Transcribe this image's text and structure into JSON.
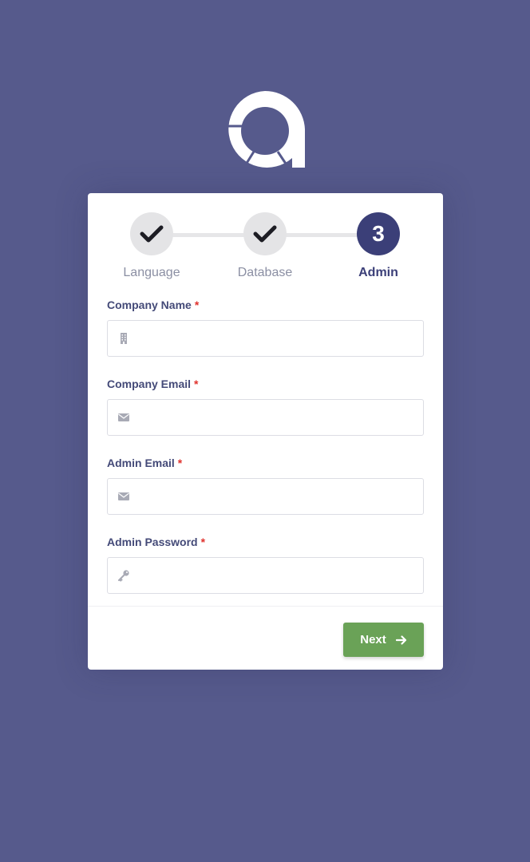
{
  "brand": {
    "logo_icon": "brand-logo-icon"
  },
  "stepper": {
    "steps": [
      {
        "label": "Language",
        "state": "done",
        "icon": "check-icon"
      },
      {
        "label": "Database",
        "state": "done",
        "icon": "check-icon"
      },
      {
        "label": "Admin",
        "state": "active",
        "number": "3"
      }
    ]
  },
  "form": {
    "required_marker": "*",
    "fields": [
      {
        "label": "Company Name",
        "value": "",
        "icon": "building-icon"
      },
      {
        "label": "Company Email",
        "value": "",
        "icon": "envelope-icon"
      },
      {
        "label": "Admin Email",
        "value": "",
        "icon": "envelope-icon"
      },
      {
        "label": "Admin Password",
        "value": "",
        "icon": "key-icon"
      }
    ]
  },
  "footer": {
    "next_label": "Next",
    "next_icon": "arrow-right-icon"
  },
  "colors": {
    "background": "#565a8c",
    "accent": "#3b3f78",
    "primary_button": "#6aa257",
    "required": "#e0322d"
  }
}
